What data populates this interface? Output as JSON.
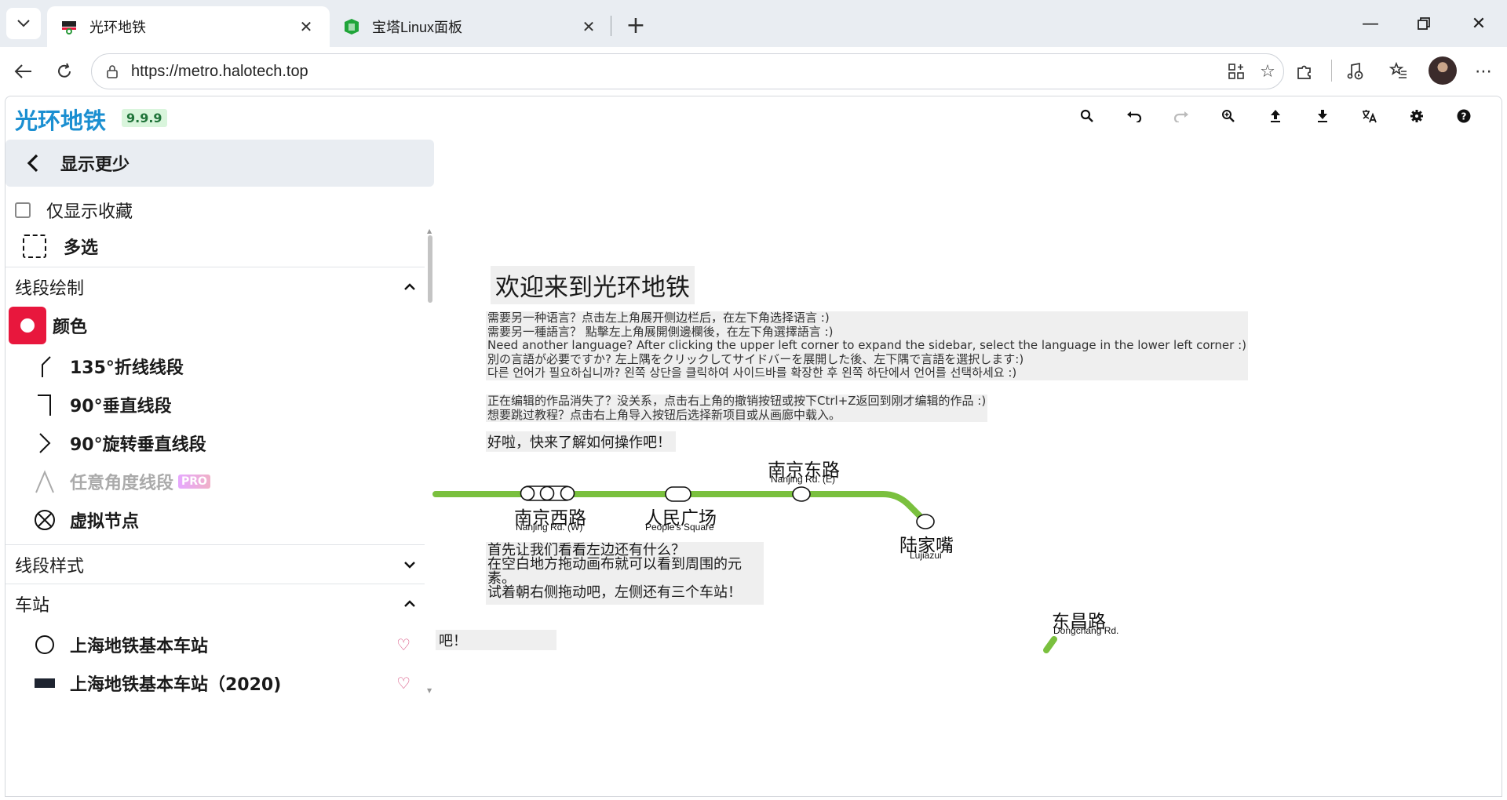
{
  "browser": {
    "tabs": [
      {
        "title": "光环地铁",
        "active": true
      },
      {
        "title": "宝塔Linux面板",
        "active": false
      }
    ],
    "url": "https://metro.halotech.top"
  },
  "app": {
    "name": "光环地铁",
    "version": "9.9.9"
  },
  "sidebar": {
    "show_less": "显示更少",
    "favorites_only": "仅显示收藏",
    "multi_select": "多选",
    "sections": {
      "line_drawing": "线段绘制",
      "line_style": "线段样式",
      "stations": "车站"
    },
    "color_label": "颜色",
    "line_items": [
      {
        "label": "135°折线线段",
        "icon": "diagonal-line-icon"
      },
      {
        "label": "90°垂直线段",
        "icon": "perpendicular-line-icon"
      },
      {
        "label": "90°旋转垂直线段",
        "icon": "rotated-perpendicular-icon"
      },
      {
        "label": "任意角度线段",
        "icon": "free-angle-icon",
        "badge": "PRO",
        "disabled": true
      },
      {
        "label": "虚拟节点",
        "icon": "virtual-node-icon"
      }
    ],
    "station_items": [
      {
        "label": "上海地铁基本车站",
        "icon": "circle-station-icon"
      },
      {
        "label": "上海地铁基本车站（2020)",
        "icon": "rect-station-icon"
      }
    ]
  },
  "canvas": {
    "welcome_title": "欢迎来到光环地铁",
    "language_notes": [
      "需要另一种语言？点击左上角展开侧边栏后，在左下角选择语言 :)",
      "需要另一種語言？ 點擊左上角展開側邊欄後，在左下角選擇語言 :)",
      "Need another language? After clicking the upper left corner to expand the sidebar, select the language in the lower left corner :)",
      "別の言語が必要ですか? 左上隅をクリックしてサイドバーを展開した後、左下隅で言語を選択します:)",
      "다른 언어가 필요하십니까? 왼쪽 상단을 클릭하여 사이드바를 확장한 후 왼쪽 하단에서 언어를 선택하세요 :)"
    ],
    "restore_notes": [
      "正在编辑的作品消失了？没关系，点击右上角的撤销按钮或按下Ctrl+Z返回到刚才编辑的作品 :)",
      "想要跳过教程？点击右上角导入按钮后选择新项目或从画廊中载入。"
    ],
    "ok_line": "好啦，快来了解如何操作吧！",
    "tip_lines": [
      "首先让我们看看左边还有什么？",
      "在空白地方拖动画布就可以看到周围的元素。",
      "试着朝右侧拖动吧，左侧还有三个车站！"
    ],
    "bottom_fragment": "吧！",
    "line_color": "#7ac03e",
    "stations": [
      {
        "zh": "南京西路",
        "en": "Nanjing Rd. (W)"
      },
      {
        "zh": "人民广场",
        "en": "People's Square"
      },
      {
        "zh": "南京东路",
        "en": "Nanjing Rd. (E)"
      },
      {
        "zh": "陆家嘴",
        "en": "Lujiazui"
      },
      {
        "zh": "东昌路",
        "en": "Dongchang Rd."
      }
    ]
  }
}
